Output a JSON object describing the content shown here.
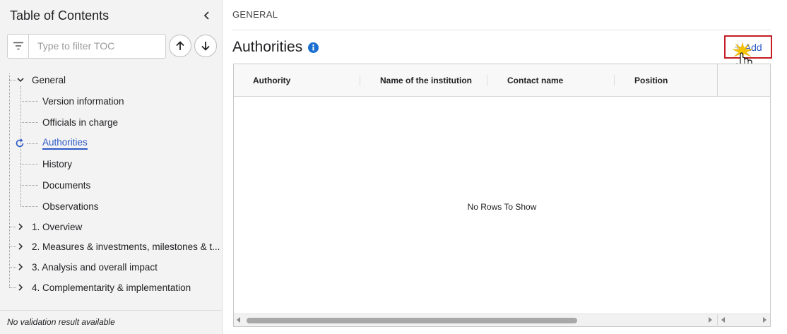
{
  "sidebar": {
    "title": "Table of Contents",
    "filter_placeholder": "Type to filter TOC",
    "tree": {
      "general": "General",
      "general_children": {
        "version_information": "Version information",
        "officials_in_charge": "Officials in charge",
        "authorities": "Authorities",
        "history": "History",
        "documents": "Documents",
        "observations": "Observations"
      },
      "sections": {
        "overview": "1. Overview",
        "measures": "2. Measures & investments, milestones & t...",
        "analysis": "3. Analysis and overall impact",
        "complementarity": "4. Complementarity & implementation"
      }
    },
    "footer": "No validation result available",
    "icons": [
      "filter-icon",
      "arrow-up-icon",
      "arrow-down-icon",
      "chevron-left-icon",
      "refresh-icon",
      "chevron-down-icon",
      "chevron-right-icon"
    ]
  },
  "main": {
    "breadcrumb": "GENERAL",
    "section_title": "Authorities",
    "add_button": {
      "plus": "+",
      "label": "Add"
    },
    "grid": {
      "columns": {
        "authority": "Authority",
        "institution": "Name of the institution",
        "contact": "Contact name",
        "position": "Position"
      },
      "empty_message": "No Rows To Show"
    }
  },
  "colors": {
    "accent": "#2c59c7",
    "info": "#1a6fd0",
    "highlight_border": "#c41d25",
    "sidebar_bg": "#f3f3f3"
  }
}
